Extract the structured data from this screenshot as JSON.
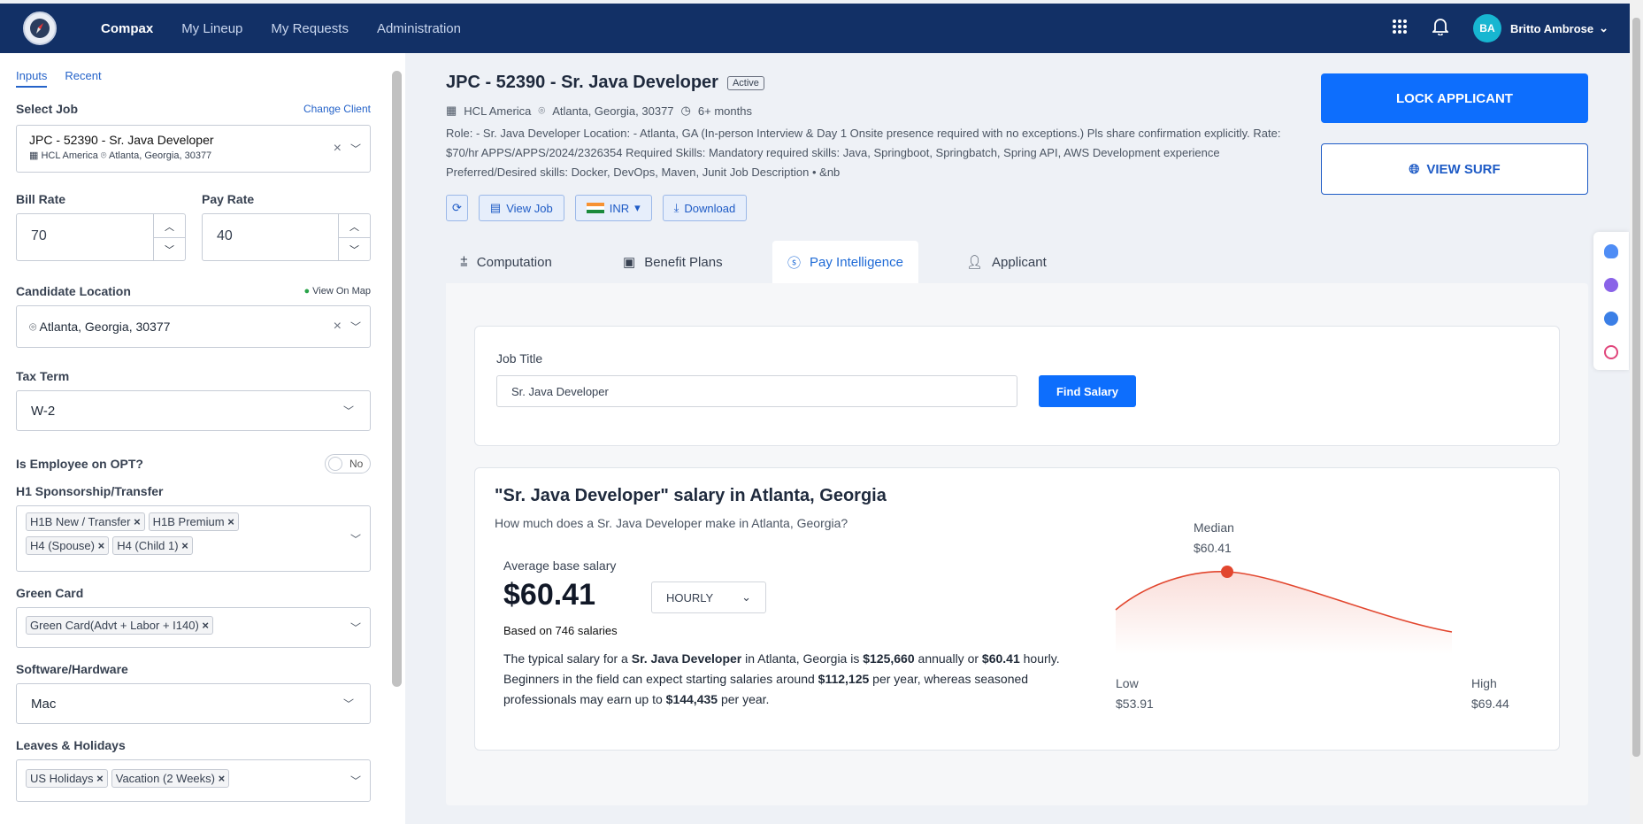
{
  "nav": {
    "links": [
      "Compax",
      "My Lineup",
      "My Requests",
      "Administration"
    ],
    "user_initials": "BA",
    "user_name": "Britto Ambrose"
  },
  "sidebar": {
    "tabs": [
      "Inputs",
      "Recent"
    ],
    "select_job": {
      "label": "Select Job",
      "link": "Change Client",
      "title": "JPC - 52390 - Sr. Java Developer",
      "client": "HCL America",
      "location": "Atlanta, Georgia, 30377"
    },
    "bill_rate": {
      "label": "Bill Rate",
      "value": "70"
    },
    "pay_rate": {
      "label": "Pay Rate",
      "value": "40"
    },
    "candidate_location": {
      "label": "Candidate Location",
      "link": "View On Map",
      "value": "Atlanta, Georgia, 30377"
    },
    "tax_term": {
      "label": "Tax Term",
      "value": "W-2"
    },
    "opt": {
      "label": "Is Employee on OPT?",
      "value": "No"
    },
    "h1": {
      "label": "H1 Sponsorship/Transfer",
      "chips": [
        "H1B New / Transfer",
        "H1B Premium",
        "H4 (Spouse)",
        "H4 (Child 1)"
      ]
    },
    "green_card": {
      "label": "Green Card",
      "chips": [
        "Green Card(Advt + Labor + I140)"
      ]
    },
    "software": {
      "label": "Software/Hardware",
      "value": "Mac"
    },
    "leaves": {
      "label": "Leaves & Holidays",
      "chips": [
        "US Holidays",
        "Vacation (2 Weeks)"
      ]
    }
  },
  "job": {
    "title": "JPC - 52390 - Sr. Java Developer",
    "status": "Active",
    "client": "HCL America",
    "location": "Atlanta, Georgia, 30377",
    "duration": "6+ months",
    "description": "Role: - Sr. Java Developer Location: - Atlanta, GA (In-person Interview & Day 1 Onsite presence required with no exceptions.) Pls share confirmation explicitly. Rate: $70/hr APPS/APPS/2024/2326354 Required Skills: Mandatory required skills: Java, Springboot, Springbatch, Spring API, AWS Development experience Preferred/Desired skills: Docker, DevOps, Maven, Junit Job Description • &nb",
    "buttons": {
      "view_job": "View Job",
      "currency": "INR",
      "download": "Download",
      "lock": "LOCK APPLICANT",
      "surf": "VIEW SURF"
    }
  },
  "tabs": [
    "Computation",
    "Benefit Plans",
    "Pay Intelligence",
    "Applicant"
  ],
  "search": {
    "label": "Job Title",
    "value": "Sr. Java Developer",
    "button": "Find Salary"
  },
  "salary": {
    "heading": "\"Sr. Java Developer\" salary in Atlanta, Georgia",
    "subheading": "How much does a Sr. Java Developer make in Atlanta, Georgia?",
    "avg_label": "Average base salary",
    "avg_value": "$60.41",
    "period": "HOURLY",
    "based_on": "Based on 746 salaries",
    "median_label": "Median",
    "median_value": "$60.41",
    "low_label": "Low",
    "low_value": "$53.91",
    "high_label": "High",
    "high_value": "$69.44",
    "para": {
      "p1": "The typical salary for a ",
      "b1": "Sr. Java Developer",
      "p2": " in Atlanta, Georgia is ",
      "b2": "$125,660",
      "p3": " annually or ",
      "b3": "$60.41",
      "p4": " hourly. Beginners in the field can expect starting salaries around ",
      "b4": "$112,125",
      "p5": " per year, whereas seasoned professionals may earn up to ",
      "b5": "$144,435",
      "p6": " per year."
    },
    "colors": {
      "curve": "#e2462e",
      "accent": "#0d6efd"
    }
  }
}
